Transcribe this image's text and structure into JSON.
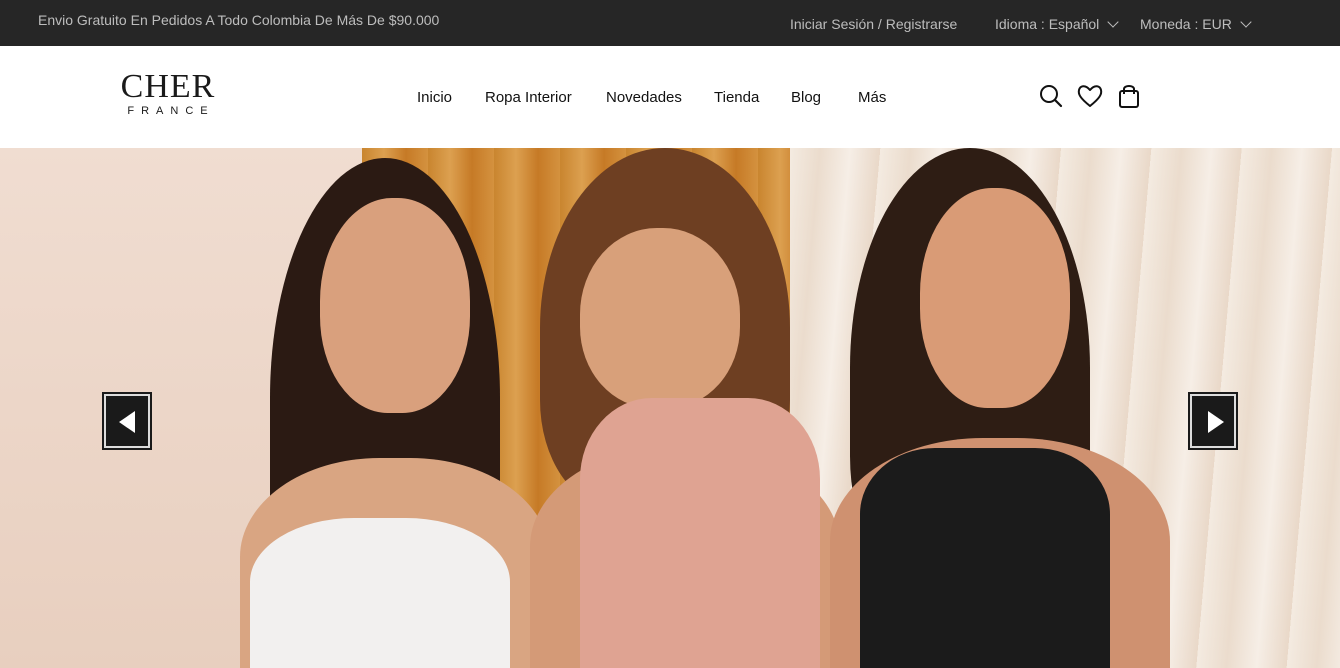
{
  "topbar": {
    "promo": "Envio Gratuito En Pedidos A Todo Colombia De Más De $90.000",
    "login": "Iniciar Sesión / Registrarse",
    "language": "Idioma : Español",
    "currency": "Moneda : EUR"
  },
  "logo": {
    "main": "CHER",
    "sub": "FRANCE"
  },
  "nav": {
    "items": [
      "Inicio",
      "Ropa Interior",
      "Novedades",
      "Tienda",
      "Blog",
      "Más"
    ]
  },
  "icons": [
    "search-icon",
    "heart-icon",
    "shopping-bag-icon",
    "arrow-left-icon",
    "arrow-right-icon"
  ],
  "colors": {
    "topbar": "#262626",
    "topbar_text": "#bdbdbd",
    "nav_text": "#111111",
    "arrow_bg": "#1a1a1a"
  }
}
